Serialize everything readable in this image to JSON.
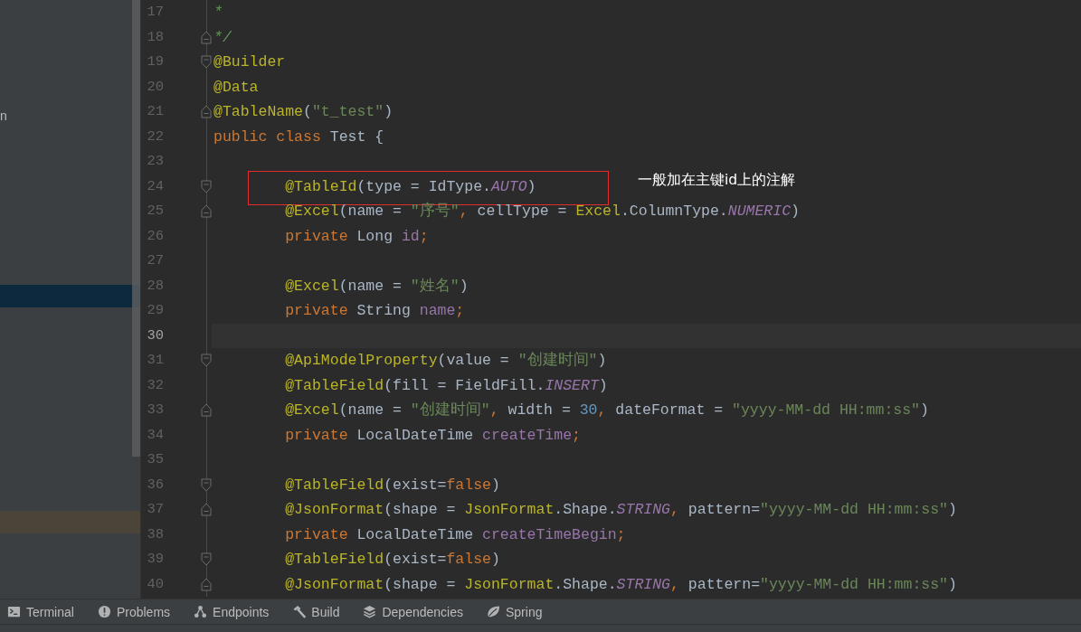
{
  "project_panel": {
    "rows": [
      {
        "text": "n",
        "selected": false,
        "highlighted": false
      },
      {
        "selected": true,
        "highlighted": false
      },
      {
        "selected": false,
        "highlighted": true
      }
    ]
  },
  "editor": {
    "lines": [
      {
        "number": "17",
        "fold_start": false,
        "fold_end": false,
        "current": false,
        "boxed": false,
        "tokens": [
          {
            "text": "*",
            "kind": "comment"
          }
        ]
      },
      {
        "number": "18",
        "fold_start": false,
        "fold_end": true,
        "current": false,
        "boxed": false,
        "tokens": [
          {
            "text": "*/",
            "kind": "comment"
          }
        ]
      },
      {
        "number": "19",
        "fold_start": true,
        "fold_end": false,
        "current": false,
        "boxed": false,
        "tokens": [
          {
            "text": "@Builder",
            "kind": "annotation"
          }
        ]
      },
      {
        "number": "20",
        "fold_start": false,
        "fold_end": false,
        "current": false,
        "boxed": false,
        "tokens": [
          {
            "text": "@Data",
            "kind": "annotation"
          }
        ]
      },
      {
        "number": "21",
        "fold_start": false,
        "fold_end": true,
        "current": false,
        "boxed": false,
        "tokens": [
          {
            "text": "@TableName",
            "kind": "annotation"
          },
          {
            "text": "(",
            "kind": "plain"
          },
          {
            "text": "\"t_test\"",
            "kind": "string"
          },
          {
            "text": ")",
            "kind": "plain"
          }
        ]
      },
      {
        "number": "22",
        "fold_start": false,
        "fold_end": false,
        "current": false,
        "boxed": false,
        "tokens": [
          {
            "text": "public class",
            "kind": "keyword"
          },
          {
            "text": " Test {",
            "kind": "plain"
          }
        ]
      },
      {
        "number": "23",
        "fold_start": false,
        "fold_end": false,
        "current": false,
        "boxed": false
      },
      {
        "number": "24",
        "fold_start": true,
        "fold_end": false,
        "current": false,
        "boxed": true,
        "callout": "一般加在主键id上的注解",
        "tokens": [
          {
            "text": "        @TableId",
            "kind": "annotation"
          },
          {
            "text": "(type = IdType.",
            "kind": "plain"
          },
          {
            "text": "AUTO",
            "kind": "constant"
          },
          {
            "text": ")",
            "kind": "plain"
          }
        ]
      },
      {
        "number": "25",
        "fold_start": false,
        "fold_end": true,
        "current": false,
        "boxed": false,
        "tokens": [
          {
            "text": "        @Excel",
            "kind": "annotation"
          },
          {
            "text": "(name = ",
            "kind": "plain"
          },
          {
            "text": "\"序号\"",
            "kind": "string"
          },
          {
            "text": ", ",
            "kind": "punct"
          },
          {
            "text": "cellType = ",
            "kind": "plain"
          },
          {
            "text": "Excel",
            "kind": "annotation"
          },
          {
            "text": ".ColumnType.",
            "kind": "plain"
          },
          {
            "text": "NUMERIC",
            "kind": "constant"
          },
          {
            "text": ")",
            "kind": "plain"
          }
        ]
      },
      {
        "number": "26",
        "fold_start": false,
        "fold_end": false,
        "current": false,
        "boxed": false,
        "tokens": [
          {
            "text": "        private",
            "kind": "keyword"
          },
          {
            "text": " Long ",
            "kind": "plain"
          },
          {
            "text": "id",
            "kind": "field"
          },
          {
            "text": ";",
            "kind": "punct"
          }
        ]
      },
      {
        "number": "27",
        "fold_start": false,
        "fold_end": false,
        "current": false,
        "boxed": false
      },
      {
        "number": "28",
        "fold_start": false,
        "fold_end": false,
        "current": false,
        "boxed": false,
        "tokens": [
          {
            "text": "        @Excel",
            "kind": "annotation"
          },
          {
            "text": "(name = ",
            "kind": "plain"
          },
          {
            "text": "\"姓名\"",
            "kind": "string"
          },
          {
            "text": ")",
            "kind": "plain"
          }
        ]
      },
      {
        "number": "29",
        "fold_start": false,
        "fold_end": false,
        "current": false,
        "boxed": false,
        "tokens": [
          {
            "text": "        private",
            "kind": "keyword"
          },
          {
            "text": " String ",
            "kind": "plain"
          },
          {
            "text": "name",
            "kind": "field"
          },
          {
            "text": ";",
            "kind": "punct"
          }
        ]
      },
      {
        "number": "30",
        "fold_start": false,
        "fold_end": false,
        "current": true,
        "boxed": false
      },
      {
        "number": "31",
        "fold_start": true,
        "fold_end": false,
        "current": false,
        "boxed": false,
        "tokens": [
          {
            "text": "        @ApiModelProperty",
            "kind": "annotation"
          },
          {
            "text": "(value = ",
            "kind": "plain"
          },
          {
            "text": "\"创建时间\"",
            "kind": "string"
          },
          {
            "text": ")",
            "kind": "plain"
          }
        ]
      },
      {
        "number": "32",
        "fold_start": false,
        "fold_end": false,
        "current": false,
        "boxed": false,
        "tokens": [
          {
            "text": "        @TableField",
            "kind": "annotation"
          },
          {
            "text": "(fill = FieldFill.",
            "kind": "plain"
          },
          {
            "text": "INSERT",
            "kind": "constant"
          },
          {
            "text": ")",
            "kind": "plain"
          }
        ]
      },
      {
        "number": "33",
        "fold_start": false,
        "fold_end": true,
        "current": false,
        "boxed": false,
        "tokens": [
          {
            "text": "        @Excel",
            "kind": "annotation"
          },
          {
            "text": "(name = ",
            "kind": "plain"
          },
          {
            "text": "\"创建时间\"",
            "kind": "string"
          },
          {
            "text": ", ",
            "kind": "punct"
          },
          {
            "text": "width = ",
            "kind": "plain"
          },
          {
            "text": "30",
            "kind": "number"
          },
          {
            "text": ", ",
            "kind": "punct"
          },
          {
            "text": "dateFormat = ",
            "kind": "plain"
          },
          {
            "text": "\"yyyy-MM-dd HH:mm:ss\"",
            "kind": "string"
          },
          {
            "text": ")",
            "kind": "plain"
          }
        ]
      },
      {
        "number": "34",
        "fold_start": false,
        "fold_end": false,
        "current": false,
        "boxed": false,
        "tokens": [
          {
            "text": "        private",
            "kind": "keyword"
          },
          {
            "text": " LocalDateTime ",
            "kind": "plain"
          },
          {
            "text": "createTime",
            "kind": "field"
          },
          {
            "text": ";",
            "kind": "punct"
          }
        ]
      },
      {
        "number": "35",
        "fold_start": false,
        "fold_end": false,
        "current": false,
        "boxed": false
      },
      {
        "number": "36",
        "fold_start": true,
        "fold_end": false,
        "current": false,
        "boxed": false,
        "tokens": [
          {
            "text": "        @TableField",
            "kind": "annotation"
          },
          {
            "text": "(exist=",
            "kind": "plain"
          },
          {
            "text": "false",
            "kind": "keyword"
          },
          {
            "text": ")",
            "kind": "plain"
          }
        ]
      },
      {
        "number": "37",
        "fold_start": false,
        "fold_end": true,
        "current": false,
        "boxed": false,
        "tokens": [
          {
            "text": "        @JsonFormat",
            "kind": "annotation"
          },
          {
            "text": "(shape = ",
            "kind": "plain"
          },
          {
            "text": "JsonFormat",
            "kind": "annotation"
          },
          {
            "text": ".Shape.",
            "kind": "plain"
          },
          {
            "text": "STRING",
            "kind": "constant"
          },
          {
            "text": ", ",
            "kind": "punct"
          },
          {
            "text": "pattern=",
            "kind": "plain"
          },
          {
            "text": "\"yyyy-MM-dd HH:mm:ss\"",
            "kind": "string"
          },
          {
            "text": ")",
            "kind": "plain"
          }
        ]
      },
      {
        "number": "38",
        "fold_start": false,
        "fold_end": false,
        "current": false,
        "boxed": false,
        "tokens": [
          {
            "text": "        private",
            "kind": "keyword"
          },
          {
            "text": " LocalDateTime ",
            "kind": "plain"
          },
          {
            "text": "createTimeBegin",
            "kind": "field"
          },
          {
            "text": ";",
            "kind": "punct"
          }
        ]
      },
      {
        "number": "39",
        "fold_start": true,
        "fold_end": false,
        "current": false,
        "boxed": false,
        "tokens": [
          {
            "text": "        @TableField",
            "kind": "annotation"
          },
          {
            "text": "(exist=",
            "kind": "plain"
          },
          {
            "text": "false",
            "kind": "keyword"
          },
          {
            "text": ")",
            "kind": "plain"
          }
        ]
      },
      {
        "number": "40",
        "fold_start": false,
        "fold_end": true,
        "current": false,
        "boxed": false,
        "tokens": [
          {
            "text": "        @JsonFormat",
            "kind": "annotation"
          },
          {
            "text": "(shape = ",
            "kind": "plain"
          },
          {
            "text": "JsonFormat",
            "kind": "annotation"
          },
          {
            "text": ".Shape.",
            "kind": "plain"
          },
          {
            "text": "STRING",
            "kind": "constant"
          },
          {
            "text": ", ",
            "kind": "punct"
          },
          {
            "text": "pattern=",
            "kind": "plain"
          },
          {
            "text": "\"yyyy-MM-dd HH:mm:ss\"",
            "kind": "string"
          },
          {
            "text": ")",
            "kind": "plain"
          }
        ]
      }
    ]
  },
  "tool_windows": [
    {
      "label": "Terminal",
      "kind": "terminal"
    },
    {
      "label": "Problems",
      "kind": "problems"
    },
    {
      "label": "Endpoints",
      "kind": "endpoints"
    },
    {
      "label": "Build",
      "kind": "build"
    },
    {
      "label": "Dependencies",
      "kind": "dependencies"
    },
    {
      "label": "Spring",
      "kind": "spring"
    }
  ]
}
